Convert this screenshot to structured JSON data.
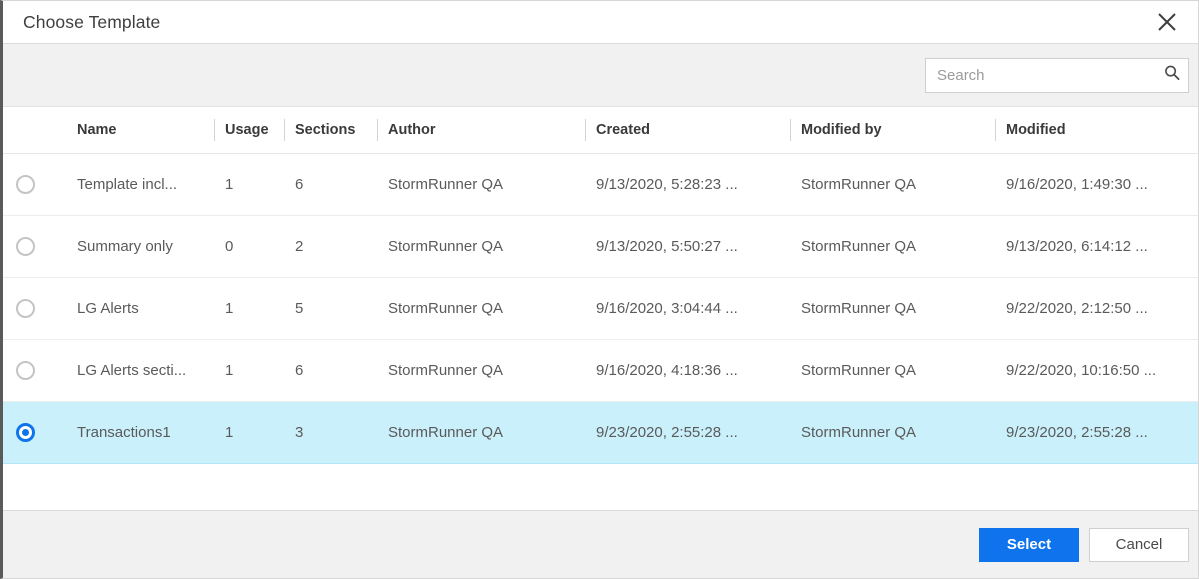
{
  "dialog": {
    "title": "Choose Template",
    "close_icon": "close-icon"
  },
  "toolbar": {
    "search_placeholder": "Search",
    "search_value": "",
    "search_icon": "search-icon"
  },
  "table": {
    "columns": [
      {
        "key": "select",
        "label": ""
      },
      {
        "key": "name",
        "label": "Name"
      },
      {
        "key": "usage",
        "label": "Usage"
      },
      {
        "key": "sections",
        "label": "Sections"
      },
      {
        "key": "author",
        "label": "Author"
      },
      {
        "key": "created",
        "label": "Created"
      },
      {
        "key": "modified_by",
        "label": "Modified by"
      },
      {
        "key": "modified",
        "label": "Modified"
      }
    ],
    "rows": [
      {
        "selected": false,
        "name": "Template incl...",
        "usage": "1",
        "sections": "6",
        "author": "StormRunner QA",
        "created": "9/13/2020, 5:28:23 ...",
        "modified_by": "StormRunner QA",
        "modified": "9/16/2020, 1:49:30 ..."
      },
      {
        "selected": false,
        "name": "Summary only",
        "usage": "0",
        "sections": "2",
        "author": "StormRunner QA",
        "created": "9/13/2020, 5:50:27 ...",
        "modified_by": "StormRunner QA",
        "modified": "9/13/2020, 6:14:12 ..."
      },
      {
        "selected": false,
        "name": "LG Alerts",
        "usage": "1",
        "sections": "5",
        "author": "StormRunner QA",
        "created": "9/16/2020, 3:04:44 ...",
        "modified_by": "StormRunner QA",
        "modified": "9/22/2020, 2:12:50 ..."
      },
      {
        "selected": false,
        "name": "LG Alerts secti...",
        "usage": "1",
        "sections": "6",
        "author": "StormRunner QA",
        "created": "9/16/2020, 4:18:36 ...",
        "modified_by": "StormRunner QA",
        "modified": "9/22/2020, 10:16:50 ..."
      },
      {
        "selected": true,
        "name": "Transactions1",
        "usage": "1",
        "sections": "3",
        "author": "StormRunner QA",
        "created": "9/23/2020, 2:55:28 ...",
        "modified_by": "StormRunner QA",
        "modified": "9/23/2020, 2:55:28 ..."
      }
    ]
  },
  "footer": {
    "select_label": "Select",
    "cancel_label": "Cancel"
  },
  "colors": {
    "accent": "#0f73ee",
    "row_selected_bg": "#c9f0fb",
    "chrome_bg": "#f1f1f1"
  }
}
